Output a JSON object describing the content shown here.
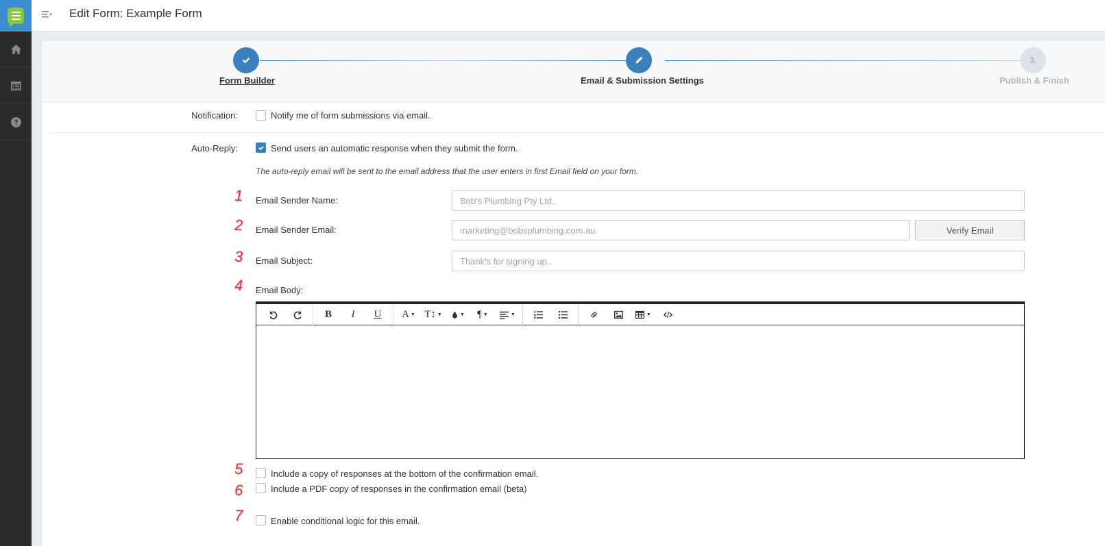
{
  "topbar": {
    "title": "Edit Form: Example Form"
  },
  "steps": [
    {
      "label": "Form Builder",
      "state": "done",
      "icon": "check-icon"
    },
    {
      "label": "Email & Submission Settings",
      "state": "current",
      "icon": "pencil-icon"
    },
    {
      "label": "Publish & Finish",
      "state": "pending",
      "number": "3."
    }
  ],
  "notification": {
    "label": "Notification:",
    "checkbox_text": "Notify me of form submissions via email.",
    "checked": false
  },
  "auto_reply": {
    "label": "Auto-Reply:",
    "checkbox_text": "Send users an automatic response when they submit the form.",
    "checked": true,
    "note": "The auto-reply email will be sent to the email address that the user enters in first Email field on your form."
  },
  "fields": {
    "sender_name": {
      "number": "1",
      "label": "Email Sender Name:",
      "placeholder": "Bob's Plumbing Pty Ltd.."
    },
    "sender_email": {
      "number": "2",
      "label": "Email Sender Email:",
      "placeholder": "marketing@bobsplumbing.com.au",
      "verify_label": "Verify Email"
    },
    "subject": {
      "number": "3",
      "label": "Email Subject:",
      "placeholder": "Thank's for signing up.."
    },
    "body": {
      "number": "4",
      "label": "Email Body:"
    }
  },
  "options": [
    {
      "number": "5",
      "text": "Include a copy of responses at the bottom of the confirmation email.",
      "checked": false
    },
    {
      "number": "6",
      "text": "Include a PDF copy of responses in the confirmation email (beta)",
      "checked": false
    },
    {
      "number": "7",
      "text": "Enable conditional logic for this email.",
      "checked": false
    }
  ],
  "editor_toolbar": {
    "bold": "B",
    "italic": "I",
    "underline": "U",
    "font": "A",
    "size": "T↕",
    "paragraph": "¶"
  },
  "colors": {
    "accent": "#3b7fbd",
    "sidebar": "#2b2b2b",
    "logo_bg": "#3b8fd0",
    "logo_bubble": "#8dc63f",
    "annotation": "#e0323c"
  }
}
